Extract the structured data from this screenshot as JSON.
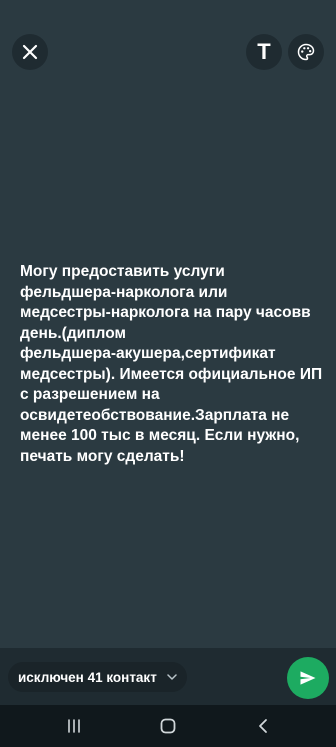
{
  "toolbar": {
    "close_icon": "close-icon",
    "text_icon_label": "T",
    "palette_icon": "palette-icon"
  },
  "status": {
    "text": "Могу предоставить услуги\nфельдшера-нарколога или\nмедсестры-нарколога на пару часовв\nдень.(диплом\nфельдшера-акушера,сертификат\nмедсестры). Имеется официальное ИП\nс разрешением на\nосвидетеобствование.Зарплата не\nменее 100 тыс в месяц. Если нужно,\nпечать могу сделать!"
  },
  "footer": {
    "privacy_label": "исключен 41 контакт",
    "send_icon": "send-icon"
  },
  "navbar": {
    "recents_icon": "recents-icon",
    "home_icon": "home-icon",
    "back_icon": "back-icon"
  },
  "colors": {
    "background": "#2b3a41",
    "send_button": "#1dab61"
  }
}
